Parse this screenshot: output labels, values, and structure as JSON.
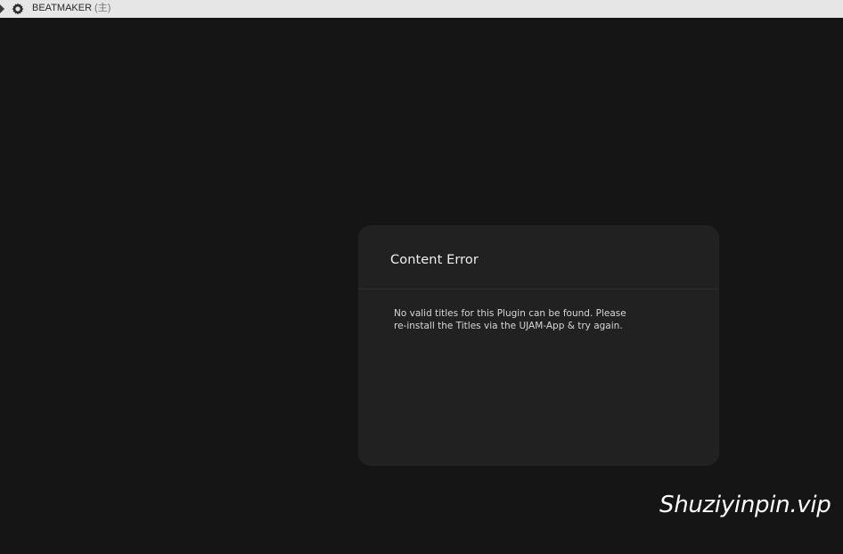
{
  "titlebar": {
    "app_name": "BEATMAKER",
    "suffix": "(主)",
    "icon": "gear-icon"
  },
  "dialog": {
    "heading": "Content Error",
    "message_line1": "No valid titles for this Plugin can be found. Please",
    "message_line2": "re-install the Titles via the UJAM-App & try again."
  },
  "watermark": {
    "text": "Shuziyinpin.vip"
  },
  "colors": {
    "background": "#151515",
    "dialog": "#212121",
    "titlebar": "#e6e6e6"
  }
}
